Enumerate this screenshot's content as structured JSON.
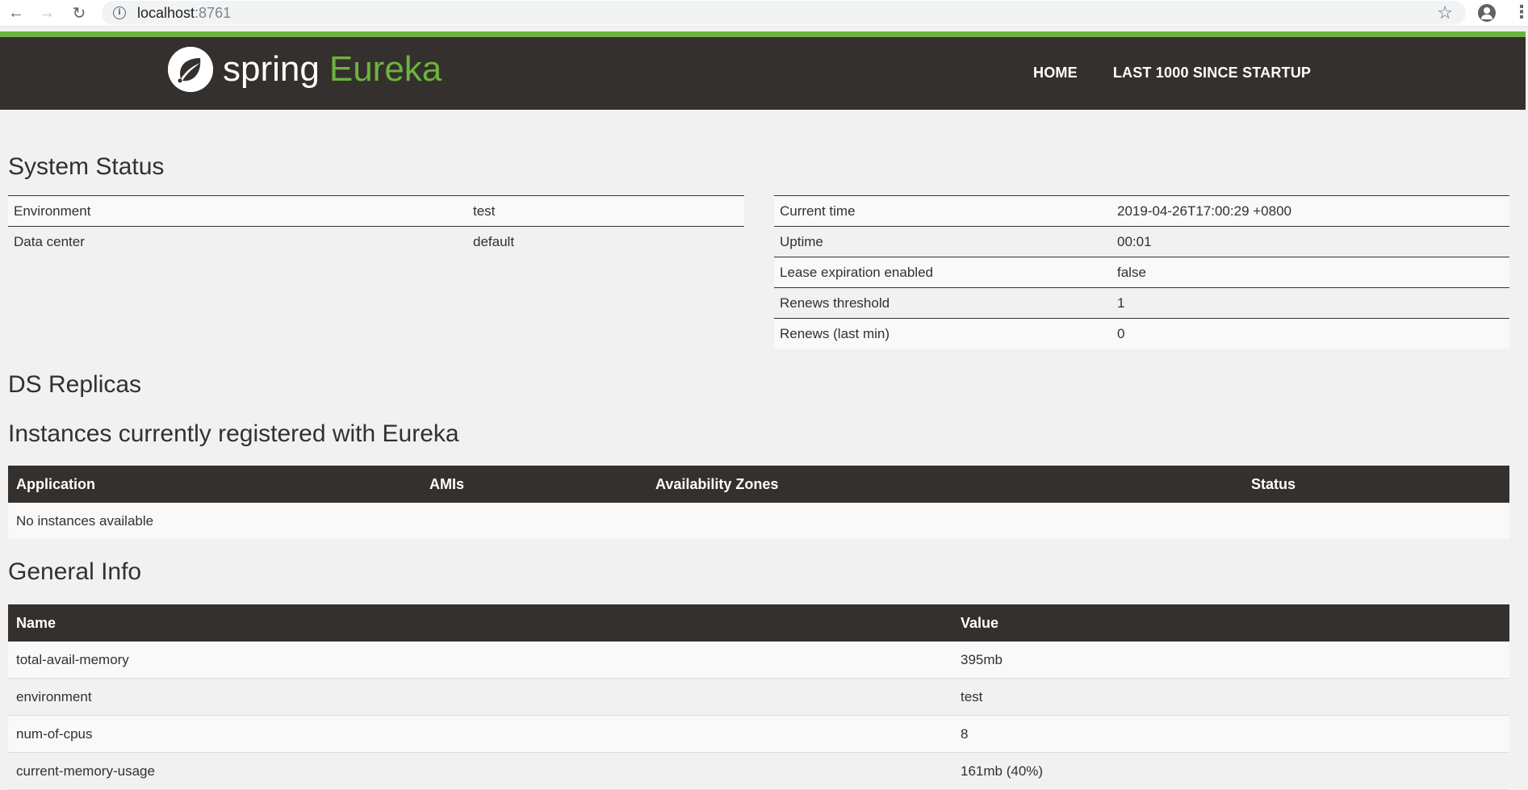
{
  "browser": {
    "url_host": "localhost",
    "url_port": ":8761"
  },
  "header": {
    "logo_spring": "spring",
    "logo_eureka": "Eureka",
    "nav": [
      {
        "label": "HOME"
      },
      {
        "label": "LAST 1000 SINCE STARTUP"
      }
    ]
  },
  "system_status": {
    "title": "System Status",
    "left": [
      {
        "key": "Environment",
        "value": "test"
      },
      {
        "key": "Data center",
        "value": "default"
      }
    ],
    "right": [
      {
        "key": "Current time",
        "value": "2019-04-26T17:00:29 +0800"
      },
      {
        "key": "Uptime",
        "value": "00:01"
      },
      {
        "key": "Lease expiration enabled",
        "value": "false"
      },
      {
        "key": "Renews threshold",
        "value": "1"
      },
      {
        "key": "Renews (last min)",
        "value": "0"
      }
    ]
  },
  "ds_replicas": {
    "title": "DS Replicas"
  },
  "instances": {
    "title": "Instances currently registered with Eureka",
    "columns": [
      "Application",
      "AMIs",
      "Availability Zones",
      "Status"
    ],
    "empty_message": "No instances available"
  },
  "general_info": {
    "title": "General Info",
    "columns": [
      "Name",
      "Value"
    ],
    "rows": [
      {
        "name": "total-avail-memory",
        "value": "395mb"
      },
      {
        "name": "environment",
        "value": "test"
      },
      {
        "name": "num-of-cpus",
        "value": "8"
      },
      {
        "name": "current-memory-usage",
        "value": "161mb (40%)"
      }
    ]
  }
}
